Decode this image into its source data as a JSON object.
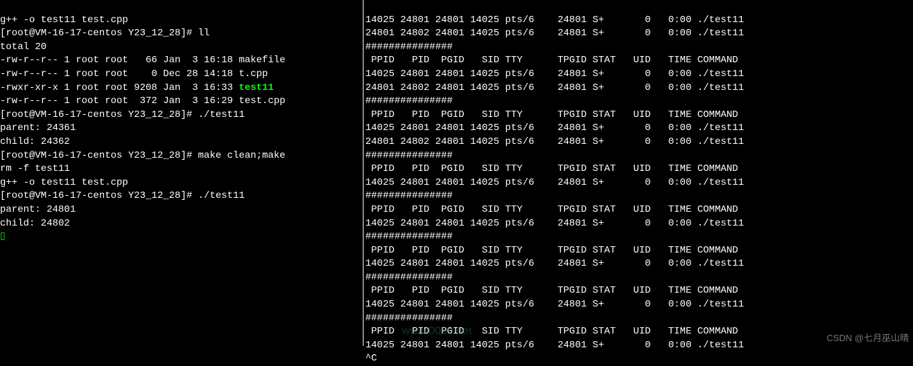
{
  "left": {
    "line0": "g++ -o test11 test.cpp",
    "prompt1": "[root@VM-16-17-centos Y23_12_28]# ",
    "cmd1": "ll",
    "total": "total 20",
    "ls": [
      "-rw-r--r-- 1 root root   66 Jan  3 16:18 makefile",
      "-rw-r--r-- 1 root root    0 Dec 28 14:18 t.cpp",
      "-rwxr-xr-x 1 root root 9208 Jan  3 16:33 ",
      "-rw-r--r-- 1 root root  372 Jan  3 16:29 test.cpp"
    ],
    "exec_name": "test11",
    "prompt2": "[root@VM-16-17-centos Y23_12_28]# ",
    "cmd2": "./test11",
    "out2a": "parent: 24361",
    "out2b": "child: 24362",
    "prompt3": "[root@VM-16-17-centos Y23_12_28]# ",
    "cmd3": "make clean;make",
    "make1": "rm -f test11",
    "make2": "g++ -o test11 test.cpp",
    "prompt4": "[root@VM-16-17-centos Y23_12_28]# ",
    "cmd4": "./test11",
    "out4a": "parent: 24801",
    "out4b": "child: 24802",
    "cursor": "▯"
  },
  "right": {
    "header": " PPID   PID  PGID   SID TTY      TPGID STAT   UID   TIME COMMAND",
    "sep": "###############",
    "r1": "14025 24801 24801 14025 pts/6    24801 S+       0   0:00 ./test11",
    "r2": "24801 24802 24801 14025 pts/6    24801 S+       0   0:00 ./test11",
    "ctrlc": "^C"
  },
  "watermark": "CSDN @七月巫山晴",
  "watermark2": "www.0069.net"
}
